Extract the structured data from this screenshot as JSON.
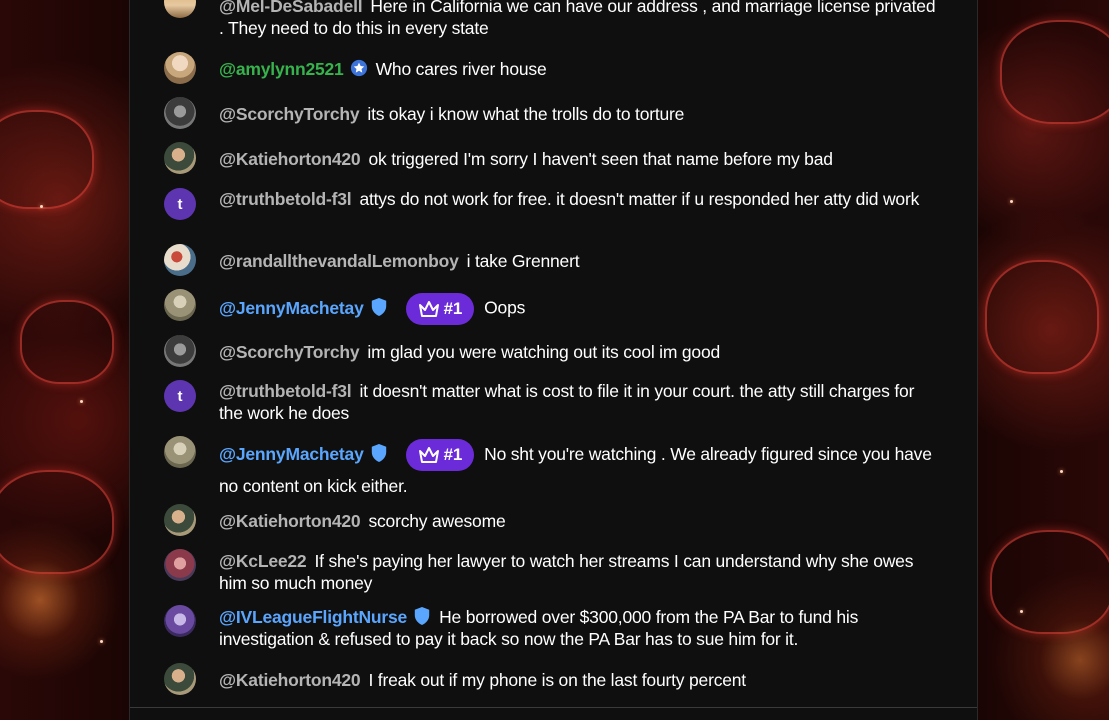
{
  "colors": {
    "panel_bg": "#0f0f0f",
    "username_default": "#b4b4b4",
    "username_member": "#5aa6ff",
    "username_green": "#37b24d",
    "crown_badge": "#6c2bd9",
    "avatar_t": "#5e35b1"
  },
  "messages": [
    {
      "user": "@Mel-DeSabadell",
      "text": "Here in California we can have our address , and marriage license privated . They need to do this in every state"
    },
    {
      "user": "@amylynn2521",
      "text": "Who cares river house",
      "badge": "star-badge-icon"
    },
    {
      "user": "@ScorchyTorchy",
      "text": "its okay i know what the trolls do to torture"
    },
    {
      "user": "@Katiehorton420",
      "text": "ok triggered I'm sorry I haven't seen that name before my bad"
    },
    {
      "user": "@truthbetold-f3l",
      "text": "attys do not work for free. it doesn't matter if u responded her atty did work",
      "avatar_letter": "t"
    },
    {
      "user": "@randallthevandalLemonboy",
      "text": "i take Grennert"
    },
    {
      "user": "@JennyMachetay",
      "text": "Oops",
      "crown_label": "#1",
      "badge": "shield-icon"
    },
    {
      "user": "@ScorchyTorchy",
      "text": "im glad you were watching out its cool im good"
    },
    {
      "user": "@truthbetold-f3l",
      "text": "it doesn't matter what is cost to file it in your court. the atty still charges for the work he does",
      "avatar_letter": "t"
    },
    {
      "user": "@JennyMachetay",
      "text": "No sht you're watching . We already figured since you have no content on kick either.",
      "crown_label": "#1",
      "badge": "shield-icon"
    },
    {
      "user": "@Katiehorton420",
      "text": "scorchy awesome"
    },
    {
      "user": "@KcLee22",
      "text": "If she's paying her lawyer to watch her streams I can understand why she owes him so much money"
    },
    {
      "user": "@IVLeagueFlightNurse",
      "text": "He borrowed over $300,000 from the PA Bar to fund his investigation & refused to pay it back so now the PA Bar has to sue him for it.",
      "badge": "shield-icon"
    },
    {
      "user": "@Katiehorton420",
      "text": "I freak out if my phone is on the last fourty percent"
    }
  ]
}
